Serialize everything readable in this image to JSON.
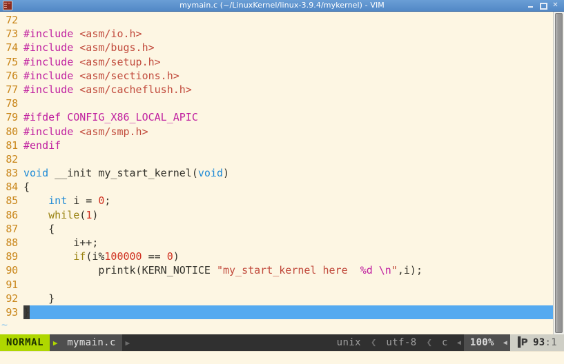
{
  "window": {
    "title": "mymain.c (~/LinuxKernel/linux-3.9.4/mykernel) - VIM",
    "icon": "vim-terminal-icon",
    "controls": {
      "minimize": "minimize-icon",
      "maximize": "maximize-icon",
      "close": "✕"
    }
  },
  "editor": {
    "filetype": "c",
    "background": "#fdf6e3",
    "cursor_line": 93,
    "cursor_col": 1,
    "lines": [
      {
        "num": "72",
        "tokens": []
      },
      {
        "num": "73",
        "tokens": [
          {
            "t": "#include ",
            "c": "c-pre"
          },
          {
            "t": "<asm/io.h>",
            "c": "c-str"
          }
        ]
      },
      {
        "num": "74",
        "tokens": [
          {
            "t": "#include ",
            "c": "c-pre"
          },
          {
            "t": "<asm/bugs.h>",
            "c": "c-str"
          }
        ]
      },
      {
        "num": "75",
        "tokens": [
          {
            "t": "#include ",
            "c": "c-pre"
          },
          {
            "t": "<asm/setup.h>",
            "c": "c-str"
          }
        ]
      },
      {
        "num": "76",
        "tokens": [
          {
            "t": "#include ",
            "c": "c-pre"
          },
          {
            "t": "<asm/sections.h>",
            "c": "c-str"
          }
        ]
      },
      {
        "num": "77",
        "tokens": [
          {
            "t": "#include ",
            "c": "c-pre"
          },
          {
            "t": "<asm/cacheflush.h>",
            "c": "c-str"
          }
        ]
      },
      {
        "num": "78",
        "tokens": []
      },
      {
        "num": "79",
        "tokens": [
          {
            "t": "#ifdef CONFIG_X86_LOCAL_APIC",
            "c": "c-pre"
          }
        ]
      },
      {
        "num": "80",
        "tokens": [
          {
            "t": "#include ",
            "c": "c-pre"
          },
          {
            "t": "<asm/smp.h>",
            "c": "c-str"
          }
        ]
      },
      {
        "num": "81",
        "tokens": [
          {
            "t": "#endif",
            "c": "c-pre"
          }
        ]
      },
      {
        "num": "82",
        "tokens": []
      },
      {
        "num": "83",
        "tokens": [
          {
            "t": "void",
            "c": "c-type"
          },
          {
            "t": " __init my_start_kernel(",
            "c": "c-plain"
          },
          {
            "t": "void",
            "c": "c-type"
          },
          {
            "t": ")",
            "c": "c-plain"
          }
        ]
      },
      {
        "num": "84",
        "tokens": [
          {
            "t": "{",
            "c": "c-plain"
          }
        ]
      },
      {
        "num": "85",
        "tokens": [
          {
            "t": "    ",
            "c": "c-plain"
          },
          {
            "t": "int",
            "c": "c-type"
          },
          {
            "t": " i = ",
            "c": "c-plain"
          },
          {
            "t": "0",
            "c": "c-num"
          },
          {
            "t": ";",
            "c": "c-plain"
          }
        ]
      },
      {
        "num": "86",
        "tokens": [
          {
            "t": "    ",
            "c": "c-plain"
          },
          {
            "t": "while",
            "c": "c-kw"
          },
          {
            "t": "(",
            "c": "c-plain"
          },
          {
            "t": "1",
            "c": "c-num"
          },
          {
            "t": ")",
            "c": "c-plain"
          }
        ]
      },
      {
        "num": "87",
        "tokens": [
          {
            "t": "    {",
            "c": "c-plain"
          }
        ]
      },
      {
        "num": "88",
        "tokens": [
          {
            "t": "        i++;",
            "c": "c-plain"
          }
        ]
      },
      {
        "num": "89",
        "tokens": [
          {
            "t": "        ",
            "c": "c-plain"
          },
          {
            "t": "if",
            "c": "c-kw"
          },
          {
            "t": "(i%",
            "c": "c-plain"
          },
          {
            "t": "100000",
            "c": "c-num"
          },
          {
            "t": " == ",
            "c": "c-plain"
          },
          {
            "t": "0",
            "c": "c-num"
          },
          {
            "t": ")",
            "c": "c-plain"
          }
        ]
      },
      {
        "num": "90",
        "tokens": [
          {
            "t": "            printk(KERN_NOTICE ",
            "c": "c-plain"
          },
          {
            "t": "\"my_start_kernel here  ",
            "c": "c-str"
          },
          {
            "t": "%d",
            "c": "c-fmt"
          },
          {
            "t": " ",
            "c": "c-str"
          },
          {
            "t": "\\n",
            "c": "c-fmt"
          },
          {
            "t": "\"",
            "c": "c-str"
          },
          {
            "t": ",i);",
            "c": "c-plain"
          }
        ]
      },
      {
        "num": "91",
        "tokens": []
      },
      {
        "num": "92",
        "tokens": [
          {
            "t": "    }",
            "c": "c-plain"
          }
        ]
      },
      {
        "num": "93",
        "tokens": [
          {
            "t": "}",
            "c": "c-plain",
            "cursor": true
          }
        ],
        "cursorline": true
      }
    ],
    "filler_marker": "~"
  },
  "statusline": {
    "mode": "NORMAL",
    "filename": "mymain.c",
    "arrow_right": "▶",
    "arrow_left": "◀",
    "fileformat": "unix",
    "encoding": "utf-8",
    "filetype": "c",
    "sep_encoding": "❮",
    "percent": "100%",
    "position_glyph": "line-number-icon",
    "line": "93",
    "col": ":1"
  }
}
